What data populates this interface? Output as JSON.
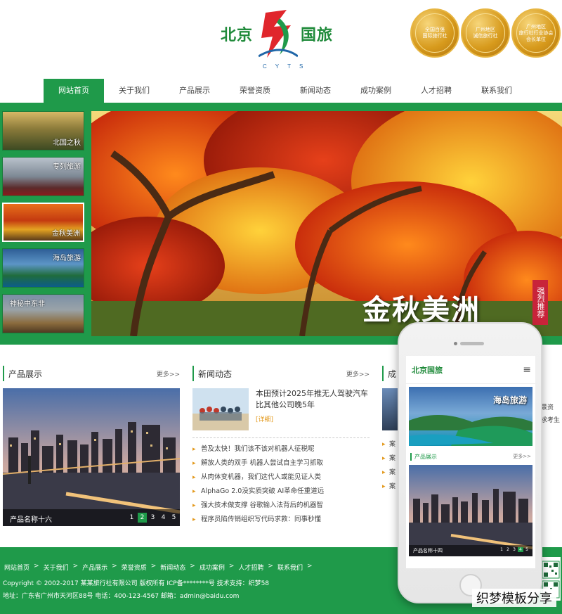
{
  "header": {
    "logo_left": "北京",
    "logo_right": "国旅",
    "logo_sub": "CYTS",
    "badges": [
      {
        "line1": "全国百强",
        "line2": "国际旅行社"
      },
      {
        "line1": "广州地区",
        "line2": "诚信旅行社"
      },
      {
        "line1": "广州地区",
        "line2": "旅行社行业协会会长单位"
      }
    ]
  },
  "nav": {
    "items": [
      {
        "label": "网站首页",
        "active": true
      },
      {
        "label": "关于我们",
        "active": false
      },
      {
        "label": "产品展示",
        "active": false
      },
      {
        "label": "荣誉资质",
        "active": false
      },
      {
        "label": "新闻动态",
        "active": false
      },
      {
        "label": "成功案例",
        "active": false
      },
      {
        "label": "人才招聘",
        "active": false
      },
      {
        "label": "联系我们",
        "active": false
      }
    ]
  },
  "slider": {
    "thumbs": [
      {
        "label": "北国之秋",
        "active": false
      },
      {
        "label": "专列旅游",
        "active": false
      },
      {
        "label": "金秋美洲",
        "active": true
      },
      {
        "label": "海岛旅游",
        "active": false
      },
      {
        "label": "神秘中东非",
        "active": false
      }
    ],
    "hero_title": "金秋美洲",
    "hero_tag": "强烈推荐"
  },
  "products": {
    "title": "产品展示",
    "more": "更多>>",
    "caption": "产品名称十六",
    "pages": [
      "1",
      "2",
      "3",
      "4",
      "5"
    ],
    "active_page": 2
  },
  "news": {
    "title": "新闻动态",
    "more": "更多>>",
    "top_title": "本田预计2025年推无人驾驶汽车 比其他公司晚5年",
    "top_detail": "[详细]",
    "items": [
      "普及太快！我们该不该对机器人征税呢",
      "解放人类的双手 机器人尝试自主学习抓取",
      "从肉体变机器，我们这代人或能见证人类",
      "AlphaGo 2.0没实质突破 AI革命任重道远",
      "强大技术做支撑 谷歌输入法背后的机器智",
      "程序员陷传销组织写代码求救：同事秒懂"
    ]
  },
  "cases": {
    "title": "成",
    "items": [
      "案",
      "案",
      "案",
      "案"
    ],
    "side_text_1": "景资",
    "side_text_2": "求考生"
  },
  "phone": {
    "logo": "北京国旅",
    "menu_icon": "≡",
    "banner_title": "海岛旅游",
    "section_title": "产品展示",
    "section_more": "更多>>",
    "prod_caption": "产品名称十四",
    "pages": [
      "1",
      "2",
      "3",
      "4",
      "5"
    ],
    "active_page": 4
  },
  "footer": {
    "links": [
      "网站首页",
      "关于我们",
      "产品展示",
      "荣誉资质",
      "新闻动态",
      "成功案例",
      "人才招聘",
      "联系我们"
    ],
    "sep": ">",
    "copyright": "Copyright © 2002-2017 某某旅行社有限公司 版权所有  ICP备********号  技术支持：织梦58",
    "address": "地址：广东省广州市天河区88号   电话：400-123-4567   邮箱：admin@baidu.com"
  },
  "watermark": "织梦模板分享"
}
